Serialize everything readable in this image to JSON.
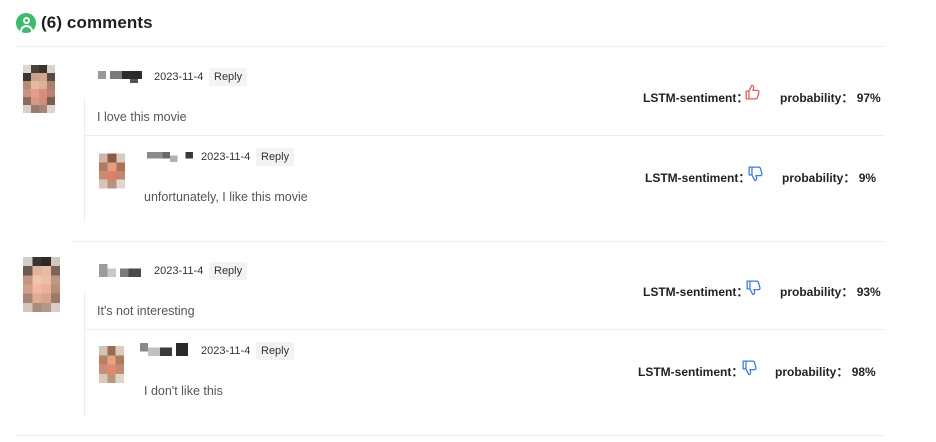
{
  "header": {
    "title": "(6) comments",
    "icon": "user-circle-icon",
    "icon_color": "#3dbb6a"
  },
  "colors": {
    "positive": "#e25c5c",
    "negative": "#3a7bd5",
    "divider": "#ececec"
  },
  "comments": [
    {
      "date": "2023-11-4",
      "reply_label": "Reply",
      "text": "I love this movie",
      "sentiment_label": "LSTM-sentiment：",
      "sentiment": "positive",
      "thumb_icon": "thumbs-up-icon",
      "probability_label": "probability：",
      "probability": "97%",
      "replies": [
        {
          "date": "2023-11-4",
          "reply_label": "Reply",
          "text": "unfortunately, I like this movie",
          "sentiment_label": "LSTM-sentiment：",
          "sentiment": "negative",
          "thumb_icon": "thumbs-down-icon",
          "probability_label": "probability：",
          "probability": "9%"
        }
      ]
    },
    {
      "date": "2023-11-4",
      "reply_label": "Reply",
      "text": "It's not interesting",
      "sentiment_label": "LSTM-sentiment：",
      "sentiment": "negative",
      "thumb_icon": "thumbs-down-icon",
      "probability_label": "probability：",
      "probability": "93%",
      "replies": [
        {
          "date": "2023-11-4",
          "reply_label": "Reply",
          "text": "I don't like this",
          "sentiment_label": "LSTM-sentiment：",
          "sentiment": "negative",
          "thumb_icon": "thumbs-down-icon",
          "probability_label": "probability：",
          "probability": "98%"
        }
      ]
    }
  ]
}
